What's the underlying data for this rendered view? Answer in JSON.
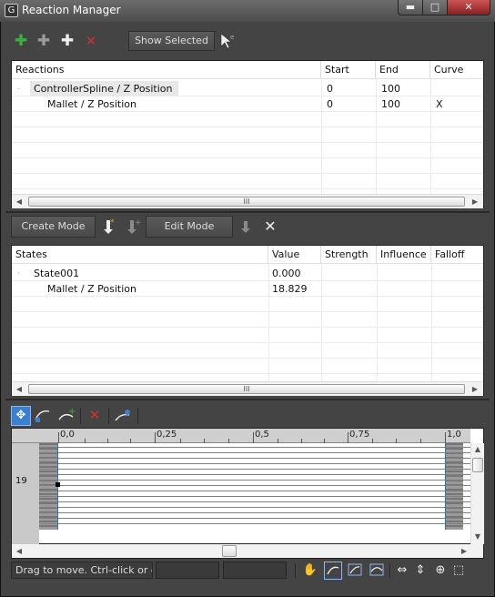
{
  "window": {
    "title": "Reaction Manager",
    "app_icon": "G",
    "minimize": "▬",
    "maximize": "□",
    "close": "✕"
  },
  "toolbar": {
    "add_master_icon": "green-plus-icon",
    "add_selected_icon": "plus-outline-icon",
    "add_icon": "plus-icon",
    "delete_icon": "red-x-icon",
    "show_selected_label": "Show Selected",
    "pick_icon": "cursor-pick-icon"
  },
  "reactions_table": {
    "columns": [
      "Reactions",
      "Start",
      "End",
      "Curve"
    ],
    "rows": [
      {
        "name": "ControllerSpline / Z Position",
        "start": "0",
        "end": "100",
        "curve": ""
      },
      {
        "name": "Mallet / Z Position",
        "start": "0",
        "end": "100",
        "curve": "X"
      }
    ]
  },
  "state_toolbar": {
    "create_mode_label": "Create Mode",
    "edit_mode_label": "Edit Mode"
  },
  "states_table": {
    "columns": [
      "States",
      "Value",
      "Strength",
      "Influence",
      "Falloff"
    ],
    "rows": [
      {
        "name": "State001",
        "value": "0.000"
      },
      {
        "name": "Mallet / Z Position",
        "value": "18.829"
      }
    ]
  },
  "curve_editor": {
    "ruler_labels": [
      "0,0",
      "0,25",
      "0,5",
      "0,75",
      "1,0"
    ],
    "row_number": "19"
  },
  "scroll_grip": "III",
  "status": {
    "text": "Drag to move. Ctrl-click or drag"
  },
  "colors": {
    "panel_bg": "#444444",
    "table_bg": "#ffffff",
    "accent_blue": "#3a7fd0",
    "delete_red": "#d03030",
    "add_green": "#3bb03b"
  }
}
